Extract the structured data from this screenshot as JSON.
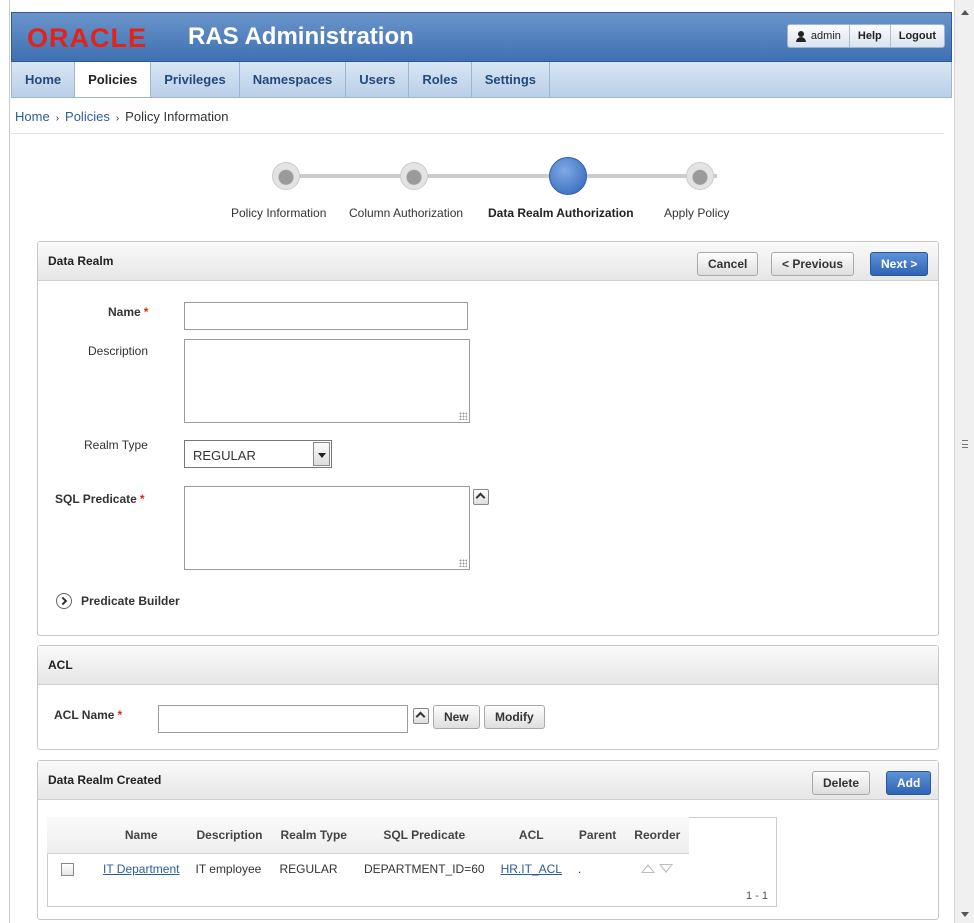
{
  "header": {
    "brand": "ORACLE",
    "app_title": "RAS Administration",
    "user": "admin",
    "help": "Help",
    "logout": "Logout"
  },
  "tabs": [
    {
      "label": "Home",
      "active": false
    },
    {
      "label": "Policies",
      "active": true
    },
    {
      "label": "Privileges",
      "active": false
    },
    {
      "label": "Namespaces",
      "active": false
    },
    {
      "label": "Users",
      "active": false
    },
    {
      "label": "Roles",
      "active": false
    },
    {
      "label": "Settings",
      "active": false
    }
  ],
  "breadcrumb": {
    "home": "Home",
    "policies": "Policies",
    "current": "Policy Information",
    "separator": "›"
  },
  "wizard": {
    "steps": [
      {
        "label": "Policy Information",
        "current": false
      },
      {
        "label": "Column Authorization",
        "current": false
      },
      {
        "label": "Data Realm Authorization",
        "current": true
      },
      {
        "label": "Apply Policy",
        "current": false
      }
    ]
  },
  "data_realm": {
    "title": "Data Realm",
    "cancel": "Cancel",
    "previous": "< Previous",
    "next": "Next >",
    "name_label": "Name",
    "name_value": "",
    "description_label": "Description",
    "realm_type_label": "Realm Type",
    "realm_type_value": "REGULAR",
    "sql_predicate_label": "SQL Predicate",
    "predicate_builder": "Predicate Builder",
    "required_mark": "*"
  },
  "acl": {
    "title": "ACL",
    "acl_name_label": "ACL Name",
    "acl_name_value": "",
    "new": "New",
    "modify": "Modify"
  },
  "created": {
    "title": "Data Realm Created",
    "delete": "Delete",
    "add": "Add",
    "columns": [
      "Name",
      "Description",
      "Realm Type",
      "SQL Predicate",
      "ACL",
      "Parent",
      "Reorder"
    ],
    "rows": [
      {
        "name": "IT Department",
        "description": "IT employee",
        "realm_type": "REGULAR",
        "sql_predicate": "DEPARTMENT_ID=60",
        "acl": "HR.IT_ACL",
        "parent": "."
      }
    ],
    "pagination": "1 - 1"
  }
}
